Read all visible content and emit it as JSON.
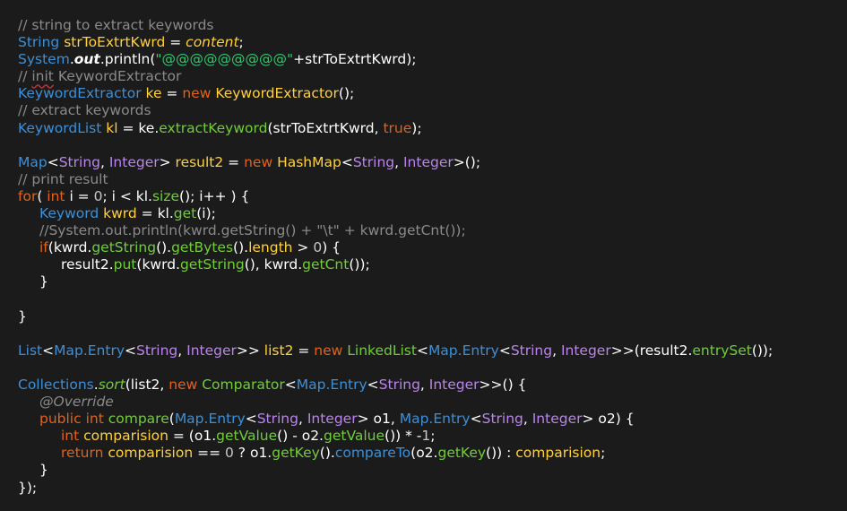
{
  "editor": {
    "colors": {
      "background": "#1b1b1b",
      "plain": "#ffffff",
      "comment": "#8a8a8a",
      "type": "#3d8fd6",
      "variable": "#ffd13a",
      "keyword": "#e2621b",
      "string": "#32c66f",
      "method": "#72cc3a",
      "generic_type": "#b985ea"
    },
    "lines": [
      {
        "indent": 0,
        "tokens": [
          {
            "t": "// string to extract keywords",
            "c": "comment"
          }
        ]
      },
      {
        "indent": 0,
        "tokens": [
          {
            "t": "String",
            "c": "type"
          },
          {
            "t": " "
          },
          {
            "t": "strToExtrtKwrd",
            "c": "var"
          },
          {
            "t": " = "
          },
          {
            "t": "content",
            "c": "var",
            "i": true
          },
          {
            "t": ";"
          }
        ]
      },
      {
        "indent": 0,
        "tokens": [
          {
            "t": "System",
            "c": "type"
          },
          {
            "t": "."
          },
          {
            "t": "out",
            "c": "plain",
            "i": true,
            "b": true
          },
          {
            "t": ".println("
          },
          {
            "t": "\"@@@@@@@@@\"",
            "c": "string"
          },
          {
            "t": "+strToExtrtKwrd);"
          }
        ]
      },
      {
        "indent": 0,
        "tokens": [
          {
            "t": "// ",
            "c": "comment"
          },
          {
            "t": "init",
            "c": "comment",
            "sq": true
          },
          {
            "t": " KeywordExtractor",
            "c": "comment"
          }
        ]
      },
      {
        "indent": 0,
        "tokens": [
          {
            "t": "KeywordExtractor",
            "c": "type"
          },
          {
            "t": " "
          },
          {
            "t": "ke",
            "c": "var"
          },
          {
            "t": " = "
          },
          {
            "t": "new",
            "c": "keyword"
          },
          {
            "t": " "
          },
          {
            "t": "KeywordExtractor",
            "c": "var"
          },
          {
            "t": "();"
          }
        ]
      },
      {
        "indent": 0,
        "tokens": [
          {
            "t": "// extract keywords",
            "c": "comment"
          }
        ]
      },
      {
        "indent": 0,
        "tokens": [
          {
            "t": "KeywordList",
            "c": "type"
          },
          {
            "t": " "
          },
          {
            "t": "kl",
            "c": "var"
          },
          {
            "t": " = ke."
          },
          {
            "t": "extractKeyword",
            "c": "method"
          },
          {
            "t": "(strToExtrtKwrd, "
          },
          {
            "t": "true",
            "c": "keyword"
          },
          {
            "t": ");"
          }
        ]
      },
      {
        "indent": 0,
        "tokens": []
      },
      {
        "indent": 0,
        "tokens": [
          {
            "t": "Map",
            "c": "type"
          },
          {
            "t": "<"
          },
          {
            "t": "String",
            "c": "generic"
          },
          {
            "t": ", "
          },
          {
            "t": "Integer",
            "c": "generic"
          },
          {
            "t": "> "
          },
          {
            "t": "result2",
            "c": "var"
          },
          {
            "t": " = "
          },
          {
            "t": "new",
            "c": "keyword"
          },
          {
            "t": " "
          },
          {
            "t": "HashMap",
            "c": "var"
          },
          {
            "t": "<"
          },
          {
            "t": "String",
            "c": "generic"
          },
          {
            "t": ", "
          },
          {
            "t": "Integer",
            "c": "generic"
          },
          {
            "t": ">();"
          }
        ]
      },
      {
        "indent": 0,
        "tokens": [
          {
            "t": "// print result",
            "c": "comment"
          }
        ]
      },
      {
        "indent": 0,
        "tokens": [
          {
            "t": "for",
            "c": "keyword"
          },
          {
            "t": "( "
          },
          {
            "t": "int",
            "c": "keyword"
          },
          {
            "t": " i = "
          },
          {
            "t": "0",
            "c": "number"
          },
          {
            "t": "; i < kl."
          },
          {
            "t": "size",
            "c": "method"
          },
          {
            "t": "(); i++ ) {"
          }
        ]
      },
      {
        "indent": 1,
        "tokens": [
          {
            "t": "Keyword",
            "c": "type"
          },
          {
            "t": " "
          },
          {
            "t": "kwrd",
            "c": "var"
          },
          {
            "t": " = kl."
          },
          {
            "t": "get",
            "c": "method"
          },
          {
            "t": "(i);"
          }
        ]
      },
      {
        "indent": 1,
        "tokens": [
          {
            "t": "//System.out.println(kwrd.getString() + \"\\t\" + kwrd.getCnt());",
            "c": "comment"
          }
        ]
      },
      {
        "indent": 1,
        "tokens": [
          {
            "t": "if",
            "c": "keyword"
          },
          {
            "t": "(kwrd."
          },
          {
            "t": "getString",
            "c": "method"
          },
          {
            "t": "()."
          },
          {
            "t": "getBytes",
            "c": "method"
          },
          {
            "t": "()."
          },
          {
            "t": "length",
            "c": "var"
          },
          {
            "t": " > "
          },
          {
            "t": "0",
            "c": "number"
          },
          {
            "t": ") {"
          }
        ]
      },
      {
        "indent": 2,
        "tokens": [
          {
            "t": "result2."
          },
          {
            "t": "put",
            "c": "method"
          },
          {
            "t": "(kwrd."
          },
          {
            "t": "getString",
            "c": "method"
          },
          {
            "t": "(), kwrd."
          },
          {
            "t": "getCnt",
            "c": "method"
          },
          {
            "t": "());"
          }
        ]
      },
      {
        "indent": 1,
        "tokens": [
          {
            "t": "}"
          }
        ]
      },
      {
        "indent": 0,
        "tokens": []
      },
      {
        "indent": 0,
        "tokens": [
          {
            "t": "}"
          }
        ]
      },
      {
        "indent": 0,
        "tokens": []
      },
      {
        "indent": 0,
        "tokens": [
          {
            "t": "List",
            "c": "type"
          },
          {
            "t": "<"
          },
          {
            "t": "Map.Entry",
            "c": "type"
          },
          {
            "t": "<"
          },
          {
            "t": "String",
            "c": "generic"
          },
          {
            "t": ", "
          },
          {
            "t": "Integer",
            "c": "generic"
          },
          {
            "t": ">> "
          },
          {
            "t": "list2",
            "c": "var"
          },
          {
            "t": " = "
          },
          {
            "t": "new",
            "c": "keyword"
          },
          {
            "t": " "
          },
          {
            "t": "LinkedList",
            "c": "method"
          },
          {
            "t": "<"
          },
          {
            "t": "Map.Entry",
            "c": "type"
          },
          {
            "t": "<"
          },
          {
            "t": "String",
            "c": "generic"
          },
          {
            "t": ", "
          },
          {
            "t": "Integer",
            "c": "generic"
          },
          {
            "t": ">>(result2."
          },
          {
            "t": "entrySet",
            "c": "method"
          },
          {
            "t": "());"
          }
        ]
      },
      {
        "indent": 0,
        "tokens": []
      },
      {
        "indent": 0,
        "tokens": [
          {
            "t": "Collections",
            "c": "type"
          },
          {
            "t": "."
          },
          {
            "t": "sort",
            "c": "method",
            "i": true
          },
          {
            "t": "(list2, "
          },
          {
            "t": "new",
            "c": "keyword"
          },
          {
            "t": " "
          },
          {
            "t": "Comparator",
            "c": "method"
          },
          {
            "t": "<"
          },
          {
            "t": "Map.Entry",
            "c": "type"
          },
          {
            "t": "<"
          },
          {
            "t": "String",
            "c": "generic"
          },
          {
            "t": ", "
          },
          {
            "t": "Integer",
            "c": "generic"
          },
          {
            "t": ">>() {"
          }
        ]
      },
      {
        "indent": 1,
        "tokens": [
          {
            "t": "@Override",
            "c": "comment",
            "i": true
          }
        ]
      },
      {
        "indent": 1,
        "tokens": [
          {
            "t": "public",
            "c": "keyword"
          },
          {
            "t": " "
          },
          {
            "t": "int",
            "c": "keyword"
          },
          {
            "t": " "
          },
          {
            "t": "compare",
            "c": "method"
          },
          {
            "t": "("
          },
          {
            "t": "Map.Entry",
            "c": "type"
          },
          {
            "t": "<"
          },
          {
            "t": "String",
            "c": "generic"
          },
          {
            "t": ", "
          },
          {
            "t": "Integer",
            "c": "generic"
          },
          {
            "t": "> o1, "
          },
          {
            "t": "Map.Entry",
            "c": "type"
          },
          {
            "t": "<"
          },
          {
            "t": "String",
            "c": "generic"
          },
          {
            "t": ", "
          },
          {
            "t": "Integer",
            "c": "generic"
          },
          {
            "t": "> o2) {"
          }
        ]
      },
      {
        "indent": 2,
        "tokens": [
          {
            "t": "int",
            "c": "keyword"
          },
          {
            "t": " "
          },
          {
            "t": "comparision",
            "c": "var"
          },
          {
            "t": " = (o1."
          },
          {
            "t": "getValue",
            "c": "method"
          },
          {
            "t": "() - o2."
          },
          {
            "t": "getValue",
            "c": "method"
          },
          {
            "t": "()) * -"
          },
          {
            "t": "1",
            "c": "number"
          },
          {
            "t": ";"
          }
        ]
      },
      {
        "indent": 2,
        "tokens": [
          {
            "t": "return",
            "c": "keyword"
          },
          {
            "t": " "
          },
          {
            "t": "comparision",
            "c": "var"
          },
          {
            "t": " == "
          },
          {
            "t": "0",
            "c": "number"
          },
          {
            "t": " ? o1."
          },
          {
            "t": "getKey",
            "c": "method"
          },
          {
            "t": "()."
          },
          {
            "t": "compareTo",
            "c": "type"
          },
          {
            "t": "(o2."
          },
          {
            "t": "getKey",
            "c": "method"
          },
          {
            "t": "()) : "
          },
          {
            "t": "comparision",
            "c": "var"
          },
          {
            "t": ";"
          }
        ]
      },
      {
        "indent": 1,
        "tokens": [
          {
            "t": "}"
          }
        ]
      },
      {
        "indent": 0,
        "tokens": [
          {
            "t": "});"
          }
        ]
      }
    ]
  }
}
